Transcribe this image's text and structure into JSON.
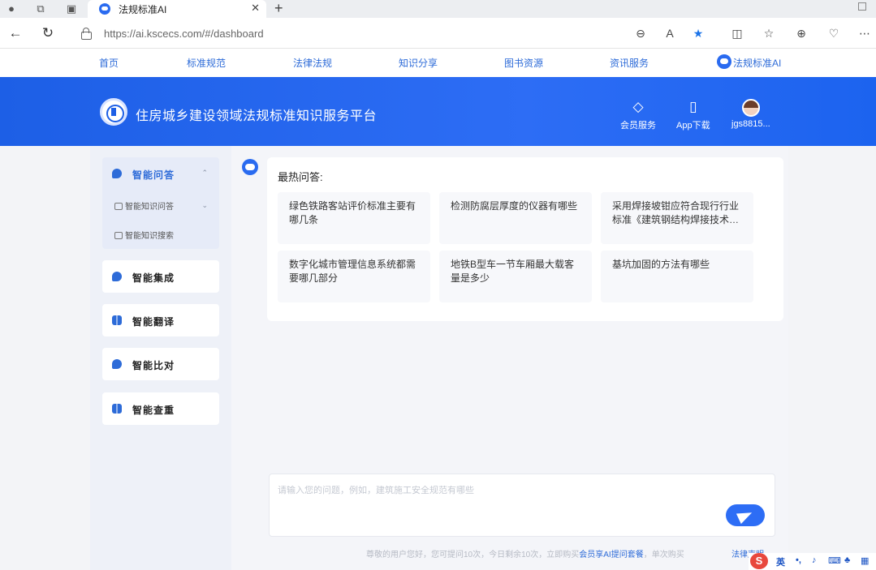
{
  "browser": {
    "tab_title": "法规标准AI",
    "tab_close": "✕",
    "new_tab": "+",
    "url": "https://ai.kscecs.com/#/dashboard"
  },
  "site_nav": {
    "items": [
      "首页",
      "标准规范",
      "法律法规",
      "知识分享",
      "图书资源",
      "资讯服务"
    ],
    "ai_label": "法规标准AI"
  },
  "header": {
    "site_title": "住房城乡建设领域法规标准知识服务平台",
    "member_label": "会员服务",
    "app_label": "App下载",
    "user_label": "jgs8815..."
  },
  "sidebar": {
    "group": {
      "label": "智能问答",
      "subitems": [
        "智能知识问答",
        "智能知识搜索"
      ]
    },
    "items": [
      {
        "label": "智能集成",
        "icon": "bubble-icon"
      },
      {
        "label": "智能翻译",
        "icon": "grid-icon"
      },
      {
        "label": "智能比对",
        "icon": "bubble-icon"
      },
      {
        "label": "智能查重",
        "icon": "grid-icon"
      }
    ]
  },
  "main": {
    "hot_title": "最热问答:",
    "questions": [
      "绿色铁路客站评价标准主要有哪几条",
      "检测防腐层厚度的仪器有哪些",
      "采用焊接坡钳应符合现行行业标准《建筑钢结构焊接技术规程》",
      "数字化城市管理信息系统都需要哪几部分",
      "地铁B型车一节车厢最大载客量是多少",
      "基坑加固的方法有哪些"
    ],
    "input_placeholder": "请输入您的问题，例如，建筑施工安全规范有哪些",
    "footer_note_before": "尊敬的用户您好，您可提问10次，今日剩余10次，立即购买",
    "footer_note_link": "会员享AI提问套餐",
    "footer_note_after": "，单次购买",
    "footer_law": "法律声明"
  },
  "ime": {
    "lang": "英"
  }
}
